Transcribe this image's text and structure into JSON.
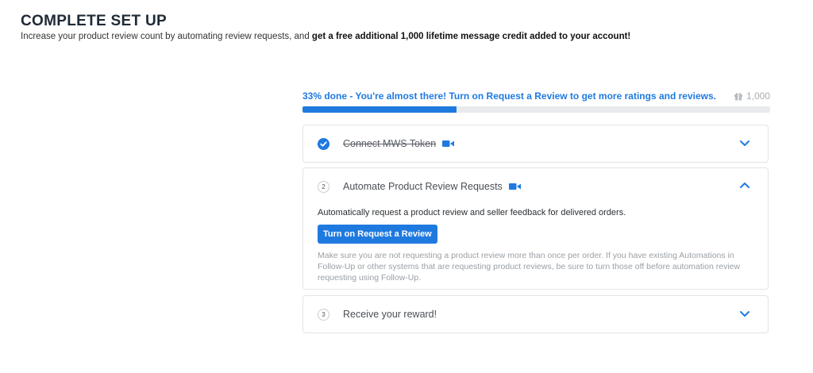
{
  "header": {
    "title": "COMPLETE SET UP",
    "subtitle_plain": "Increase your product review count by automating review requests, and ",
    "subtitle_bold": "get a free additional 1,000 lifetime message credit added to your account!"
  },
  "progress": {
    "text": "33% done - You're almost there! Turn on Request a Review to get more ratings and reviews.",
    "percent": 33,
    "reward_count": "1,000",
    "reward_icon": "gift-icon"
  },
  "steps": [
    {
      "number": "1",
      "title": "Connect MWS Token",
      "status": "done",
      "expanded": false
    },
    {
      "number": "2",
      "title": "Automate Product Review Requests",
      "status": "active",
      "expanded": true,
      "description": "Automatically request a product review and seller feedback for delivered orders.",
      "button_label": "Turn on Request a Review",
      "note": "Make sure you are not requesting a product review more than once per order. If you have existing Automations in Follow-Up or other systems that are requesting product reviews, be sure to turn those off before automation review requesting using Follow-Up."
    },
    {
      "number": "3",
      "title": "Receive your reward!",
      "status": "pending",
      "expanded": false
    }
  ],
  "colors": {
    "accent": "#1f7ae0",
    "muted": "#9aa0a6",
    "border": "#e1e4e8"
  }
}
